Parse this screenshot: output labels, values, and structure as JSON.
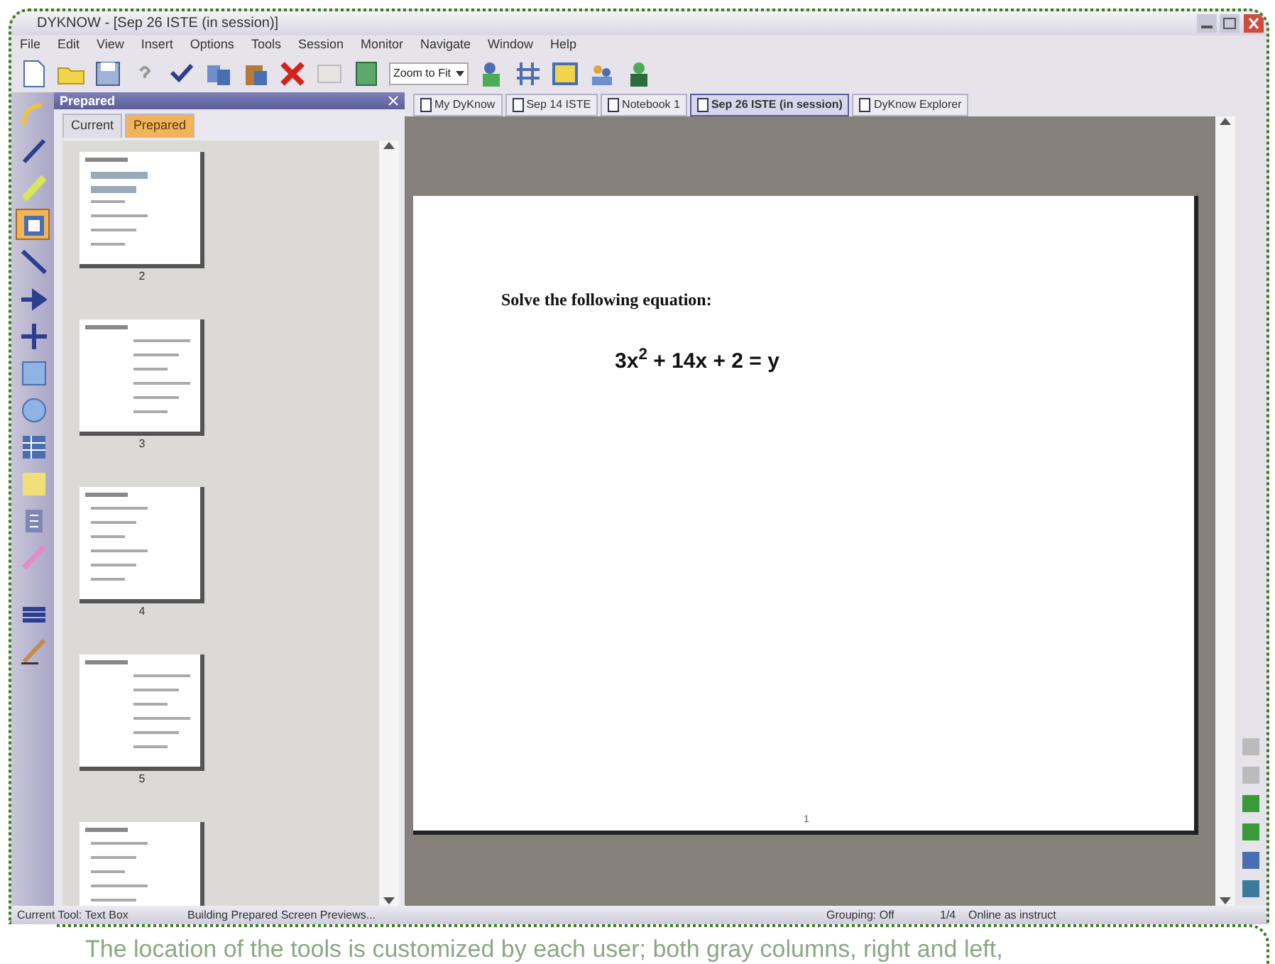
{
  "window": {
    "title": "DYKNOW - [Sep 26 ISTE (in session)]"
  },
  "menu": [
    "File",
    "Edit",
    "View",
    "Insert",
    "Options",
    "Tools",
    "Session",
    "Monitor",
    "Navigate",
    "Window",
    "Help"
  ],
  "toolbar": {
    "zoom": "Zoom to Fit"
  },
  "left_tools": [
    {
      "selected": false
    },
    {
      "selected": false
    },
    {
      "selected": false
    },
    {
      "selected": true
    },
    {
      "selected": false
    },
    {
      "selected": false
    },
    {
      "selected": false
    },
    {
      "selected": false
    },
    {
      "selected": false
    },
    {
      "selected": false
    },
    {
      "selected": false
    },
    {
      "selected": false
    },
    {
      "selected": false
    },
    {
      "selected": false
    },
    {
      "selected": false
    }
  ],
  "panel": {
    "title": "Prepared",
    "tabs": [
      {
        "label": "Current",
        "selected": false
      },
      {
        "label": "Prepared",
        "selected": true
      }
    ],
    "slides": [
      {
        "kind": "full",
        "number": "2"
      },
      {
        "kind": "full",
        "number": "3"
      },
      {
        "kind": "full",
        "number": "4"
      },
      {
        "kind": "full",
        "number": "5"
      },
      {
        "kind": "partial"
      }
    ]
  },
  "doc_tabs": [
    {
      "label": "My DyKnow",
      "selected": false
    },
    {
      "label": "Sep 14 ISTE",
      "selected": false
    },
    {
      "label": "Notebook 1",
      "selected": false
    },
    {
      "label": "Sep 26 ISTE (in session)",
      "selected": true
    },
    {
      "label": "DyKnow Explorer",
      "selected": false
    }
  ],
  "slide": {
    "heading": "Solve the following equation:",
    "equation": "3x$^{2}$ + 14x + 2 = y",
    "page_number": "1"
  },
  "status_bar": [
    "Current Tool: Text Box",
    "Building Prepared Screen Previews...",
    "Grouping: Off",
    "1/4",
    "Online as instruct"
  ],
  "caption": "The location of the tools is customized by each user; both gray columns, right and left,"
}
